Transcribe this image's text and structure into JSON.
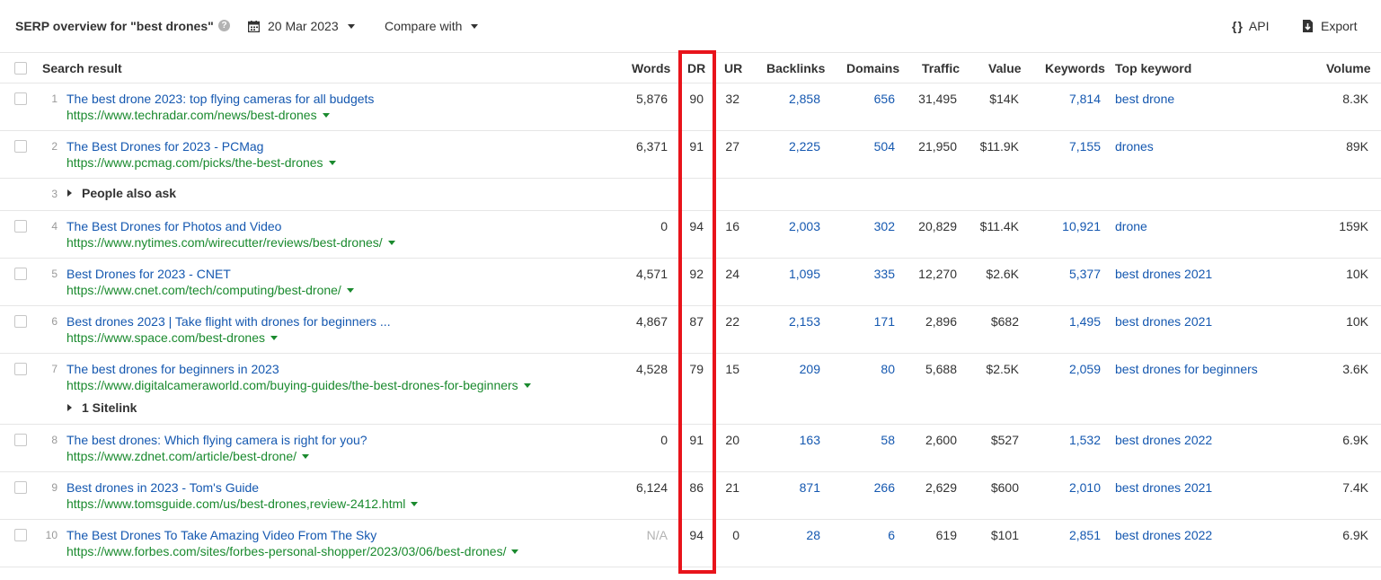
{
  "toolbar": {
    "title": "SERP overview for \"best drones\"",
    "help_icon": "?",
    "date": "20 Mar 2023",
    "compare": "Compare with",
    "api": "API",
    "api_icon": "{}",
    "export": "Export"
  },
  "columns": {
    "search_result": "Search result",
    "words": "Words",
    "dr": "DR",
    "ur": "UR",
    "backlinks": "Backlinks",
    "domains": "Domains",
    "traffic": "Traffic",
    "value": "Value",
    "keywords": "Keywords",
    "top_keyword": "Top keyword",
    "volume": "Volume"
  },
  "rows": [
    {
      "pos": "1",
      "title": "The best drone 2023: top flying cameras for all budgets",
      "url": "https://www.techradar.com/news/best-drones",
      "words": "5,876",
      "dr": "90",
      "ur": "32",
      "backlinks": "2,858",
      "domains": "656",
      "traffic": "31,495",
      "value": "$14K",
      "keywords": "7,814",
      "top_keyword": "best drone",
      "volume": "8.3K"
    },
    {
      "pos": "2",
      "title": "The Best Drones for 2023 - PCMag",
      "url": "https://www.pcmag.com/picks/the-best-drones",
      "words": "6,371",
      "dr": "91",
      "ur": "27",
      "backlinks": "2,225",
      "domains": "504",
      "traffic": "21,950",
      "value": "$11.9K",
      "keywords": "7,155",
      "top_keyword": "drones",
      "volume": "89K"
    },
    {
      "pos": "3",
      "label": "People also ask"
    },
    {
      "pos": "4",
      "title": "The Best Drones for Photos and Video",
      "url": "https://www.nytimes.com/wirecutter/reviews/best-drones/",
      "words": "0",
      "dr": "94",
      "ur": "16",
      "backlinks": "2,003",
      "domains": "302",
      "traffic": "20,829",
      "value": "$11.4K",
      "keywords": "10,921",
      "top_keyword": "drone",
      "volume": "159K"
    },
    {
      "pos": "5",
      "title": "Best Drones for 2023 - CNET",
      "url": "https://www.cnet.com/tech/computing/best-drone/",
      "words": "4,571",
      "dr": "92",
      "ur": "24",
      "backlinks": "1,095",
      "domains": "335",
      "traffic": "12,270",
      "value": "$2.6K",
      "keywords": "5,377",
      "top_keyword": "best drones 2021",
      "volume": "10K"
    },
    {
      "pos": "6",
      "title": "Best drones 2023 | Take flight with drones for beginners ...",
      "url": "https://www.space.com/best-drones",
      "words": "4,867",
      "dr": "87",
      "ur": "22",
      "backlinks": "2,153",
      "domains": "171",
      "traffic": "2,896",
      "value": "$682",
      "keywords": "1,495",
      "top_keyword": "best drones 2021",
      "volume": "10K"
    },
    {
      "pos": "7",
      "title": "The best drones for beginners in 2023",
      "url": "https://www.digitalcameraworld.com/buying-guides/the-best-drones-for-beginners",
      "words": "4,528",
      "dr": "79",
      "ur": "15",
      "backlinks": "209",
      "domains": "80",
      "traffic": "5,688",
      "value": "$2.5K",
      "keywords": "2,059",
      "top_keyword": "best drones for beginners",
      "volume": "3.6K",
      "sitelink": "1 Sitelink"
    },
    {
      "pos": "8",
      "title": "The best drones: Which flying camera is right for you?",
      "url": "https://www.zdnet.com/article/best-drone/",
      "words": "0",
      "dr": "91",
      "ur": "20",
      "backlinks": "163",
      "domains": "58",
      "traffic": "2,600",
      "value": "$527",
      "keywords": "1,532",
      "top_keyword": "best drones 2022",
      "volume": "6.9K"
    },
    {
      "pos": "9",
      "title": "Best drones in 2023 - Tom's Guide",
      "url": "https://www.tomsguide.com/us/best-drones,review-2412.html",
      "words": "6,124",
      "dr": "86",
      "ur": "21",
      "backlinks": "871",
      "domains": "266",
      "traffic": "2,629",
      "value": "$600",
      "keywords": "2,010",
      "top_keyword": "best drones 2021",
      "volume": "7.4K"
    },
    {
      "pos": "10",
      "title": "The Best Drones To Take Amazing Video From The Sky",
      "url": "https://www.forbes.com/sites/forbes-personal-shopper/2023/03/06/best-drones/",
      "words": "N/A",
      "dr": "94",
      "ur": "0",
      "backlinks": "28",
      "domains": "6",
      "traffic": "619",
      "value": "$101",
      "keywords": "2,851",
      "top_keyword": "best drones 2022",
      "volume": "6.9K"
    }
  ],
  "colors": {
    "title_link": "#1558b0",
    "url_link": "#1a8a2e",
    "highlight": "#e8141b"
  }
}
